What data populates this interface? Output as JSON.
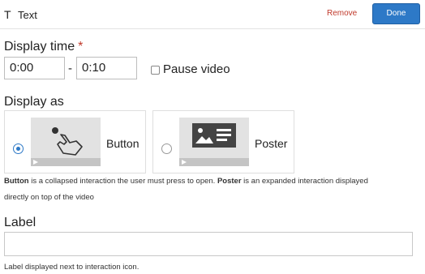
{
  "header": {
    "icon_glyph": "T",
    "title": "Text",
    "remove_label": "Remove",
    "done_label": "Done"
  },
  "display_time": {
    "label": "Display time",
    "required_marker": "*",
    "start_value": "0:00",
    "separator": "-",
    "end_value": "0:10",
    "pause_label": "Pause video",
    "pause_checked": false
  },
  "display_as": {
    "label": "Display as",
    "options": [
      {
        "label": "Button",
        "selected": true,
        "thumb_icon": "tap-gesture-icon"
      },
      {
        "label": "Poster",
        "selected": false,
        "thumb_icon": "poster-image-icon"
      }
    ],
    "help": {
      "term_button": "Button",
      "text_1": " is a collapsed interaction the user must press to open. ",
      "term_poster": "Poster",
      "text_2": " is an expanded interaction displayed",
      "text_3": "directly on top of the video"
    }
  },
  "label_field": {
    "label": "Label",
    "value": "",
    "help": "Label displayed next to interaction icon."
  },
  "colors": {
    "primary": "#2d79c7",
    "danger": "#c0392b"
  }
}
